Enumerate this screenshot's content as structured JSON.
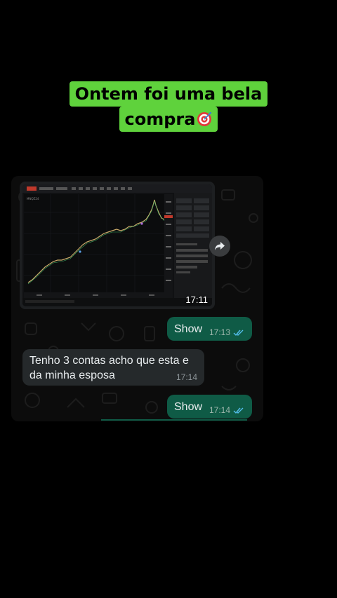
{
  "caption": {
    "line1": "Ontem foi uma bela",
    "line2": "compra",
    "emoji": "direct-hit-target-icon",
    "bg_color": "#5fd23c"
  },
  "chat": {
    "image_message": {
      "time": "17:11",
      "chart_platform_label": "Chart",
      "side_panel_title": "Mini-DOM"
    },
    "forward_icon": "share-forward-icon",
    "messages": [
      {
        "direction": "outgoing",
        "text": "Show",
        "time": "17:13",
        "status": "read-double-check"
      },
      {
        "direction": "incoming",
        "text": "Tenho 3 contas acho que esta e da minha esposa",
        "time": "17:14"
      },
      {
        "direction": "outgoing",
        "text": "Show",
        "time": "17:14",
        "status": "read-double-check"
      }
    ],
    "colors": {
      "outgoing": "#0f5b46",
      "incoming": "#25292b",
      "read_ticks": "#53bdeb"
    }
  }
}
